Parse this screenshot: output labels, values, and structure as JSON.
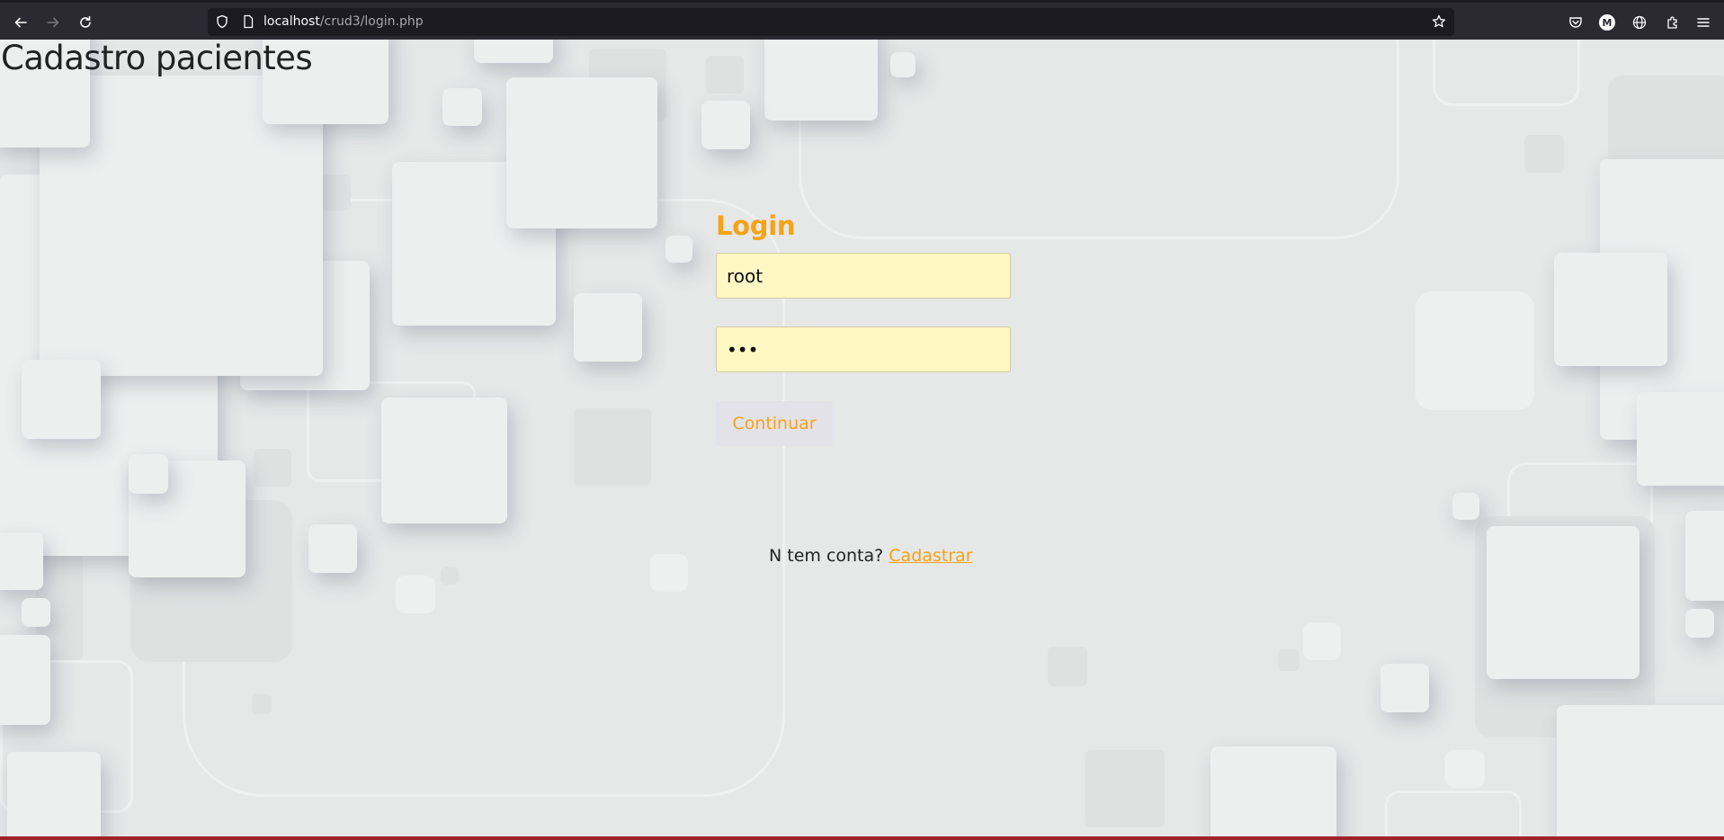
{
  "browser": {
    "url_host": "localhost",
    "url_path": "/crud3/login.php",
    "profile_initial": "M"
  },
  "page": {
    "title": "Cadastro pacientes"
  },
  "login": {
    "heading": "Login",
    "username_value": "root",
    "password_value": "abc",
    "continue_label": "Continuar",
    "no_account_text": "N tem conta?",
    "signup_link": "Cadastrar"
  },
  "colors": {
    "accent": "#f5a316",
    "input_bg": "#fff8c4",
    "page_bg": "#e6e7e7",
    "chrome_bg": "#2b2a33"
  },
  "icons": {
    "nav": [
      "back-arrow-icon",
      "forward-arrow-icon",
      "reload-icon"
    ],
    "urlbar": [
      "shield-icon",
      "page-icon",
      "star-icon"
    ],
    "toolbar_right": [
      "pocket-icon",
      "account-icon",
      "globe-icon",
      "extensions-icon",
      "menu-icon"
    ]
  }
}
